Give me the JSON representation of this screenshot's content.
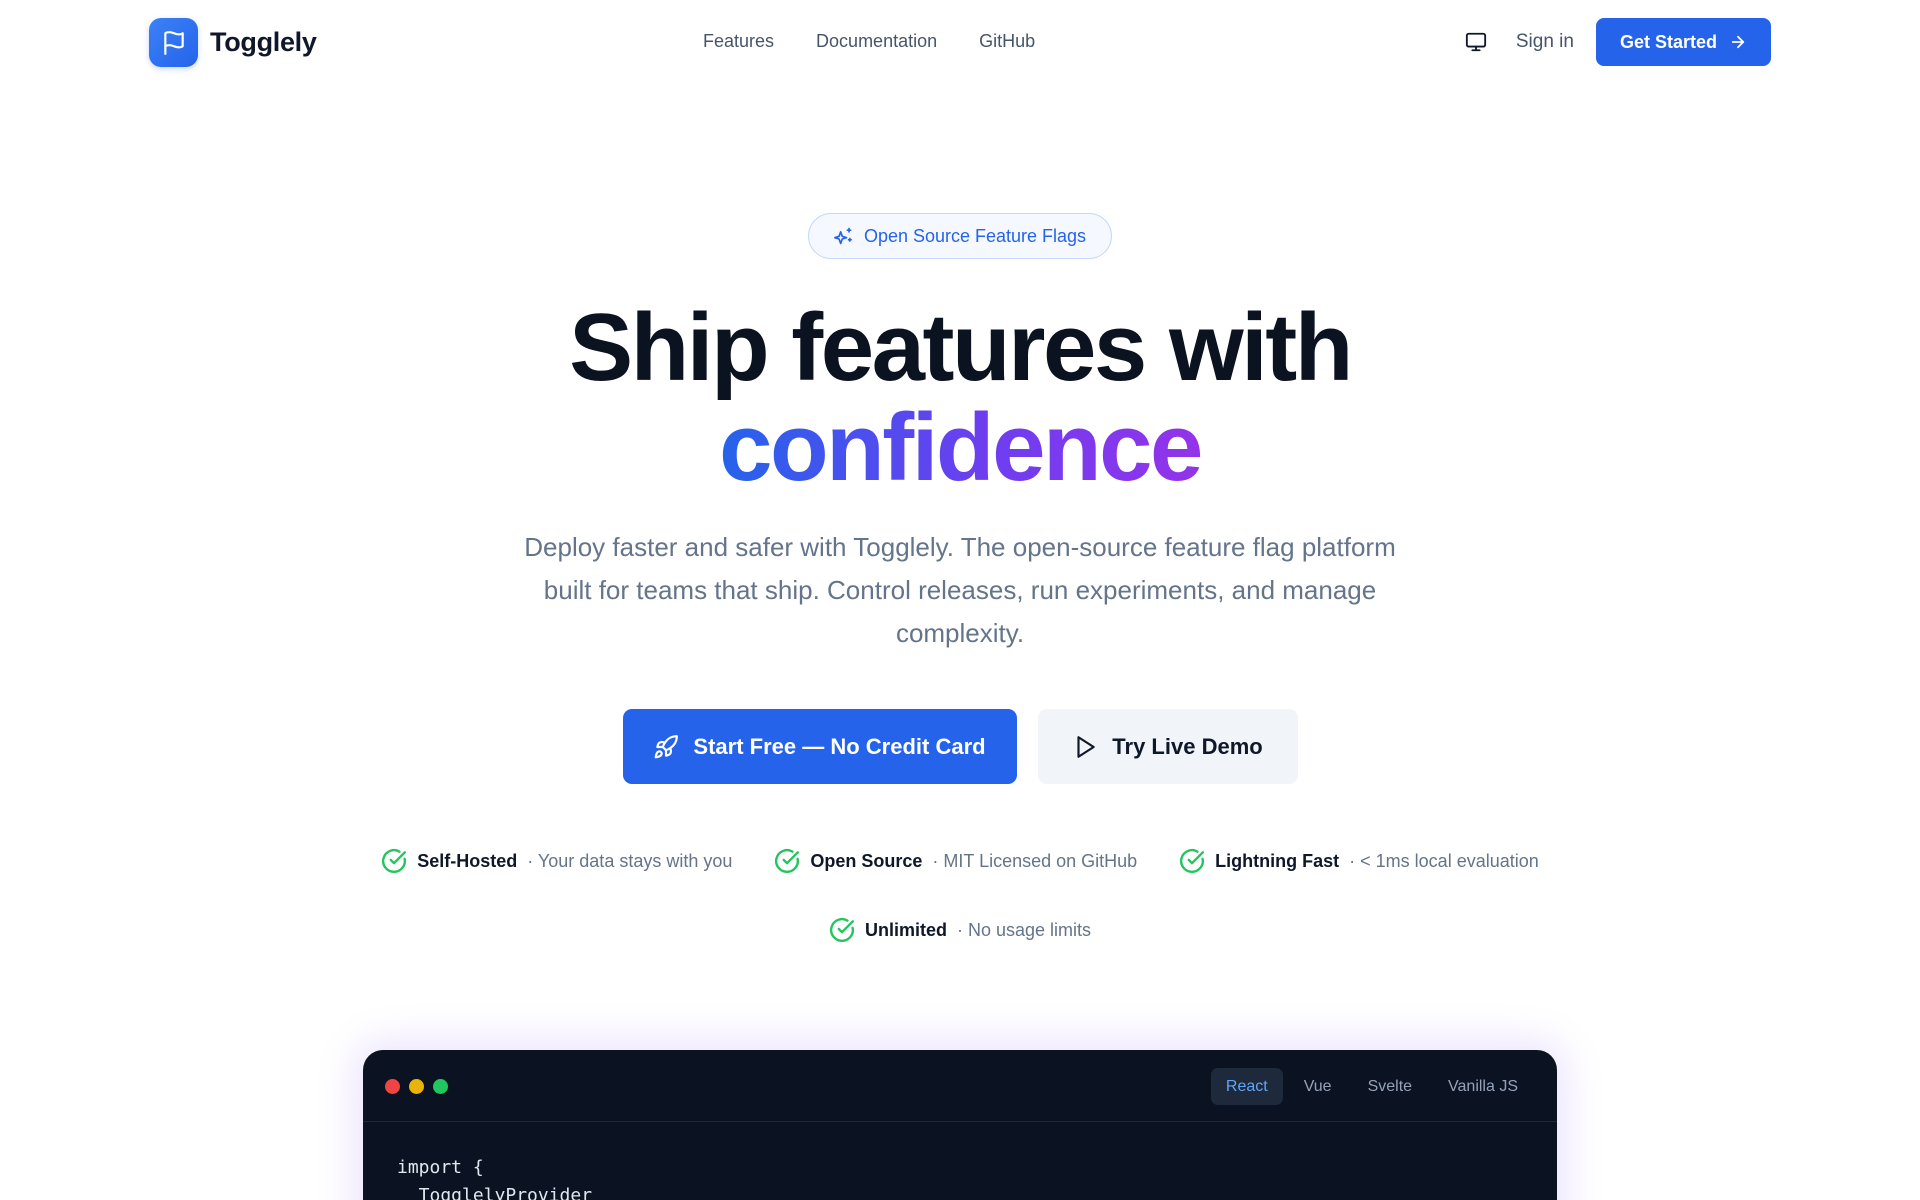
{
  "brand": {
    "name": "Togglely",
    "icon": "flag-icon"
  },
  "nav": {
    "links": [
      "Features",
      "Documentation",
      "GitHub"
    ],
    "theme_icon": "monitor-icon",
    "signin_label": "Sign in",
    "cta_label": "Get Started",
    "cta_icon": "arrow-right-icon"
  },
  "hero": {
    "badge": "Open Source Feature Flags",
    "badge_icon": "sparkles-icon",
    "headline_line1": "Ship features with",
    "headline_line2": "confidence",
    "subtitle": "Deploy faster and safer with Togglely. The open-source feature flag platform built for teams that ship. Control releases, run experiments, and manage complexity.",
    "primary_cta": "Start Free — No Credit Card",
    "primary_cta_icon": "rocket-icon",
    "secondary_cta": "Try Live Demo",
    "secondary_cta_icon": "play-icon"
  },
  "features": [
    {
      "title": "Self-Hosted",
      "desc": "· Your data stays with you"
    },
    {
      "title": "Open Source",
      "desc": "· MIT Licensed on GitHub"
    },
    {
      "title": "Lightning Fast",
      "desc": "· < 1ms local evaluation"
    },
    {
      "title": "Unlimited",
      "desc": "· No usage limits"
    }
  ],
  "code": {
    "tabs": [
      "React",
      "Vue",
      "Svelte",
      "Vanilla JS"
    ],
    "active_tab": "React",
    "lines": [
      "import {",
      "  TogglelyProvider"
    ]
  },
  "colors": {
    "primary": "#2563eb",
    "gradient_start": "#2563eb",
    "gradient_end": "#9333ea",
    "check": "#22c55e",
    "code_bg": "#0b1221"
  }
}
